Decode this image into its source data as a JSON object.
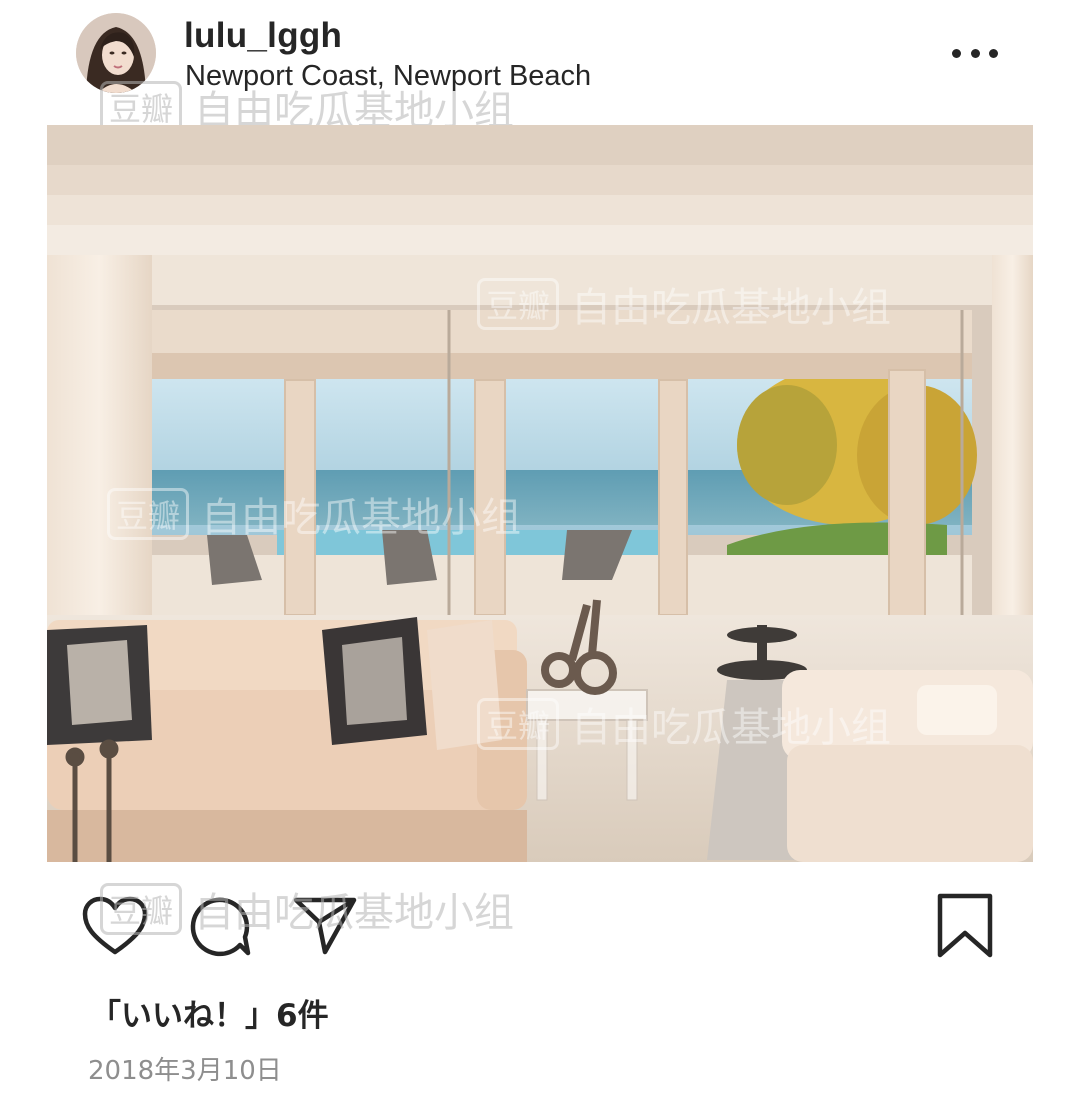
{
  "post": {
    "username": "lulu_lggh",
    "location": "Newport Coast, Newport Beach",
    "likes_text": "「いいね！」6件",
    "date": "2018年3月10日"
  },
  "watermark": {
    "logo": "豆瓣",
    "text": "自由吃瓜基地小组"
  },
  "icons": {
    "more": "more-options-icon",
    "like": "heart-icon",
    "comment": "comment-icon",
    "share": "paper-plane-icon",
    "save": "bookmark-icon"
  }
}
